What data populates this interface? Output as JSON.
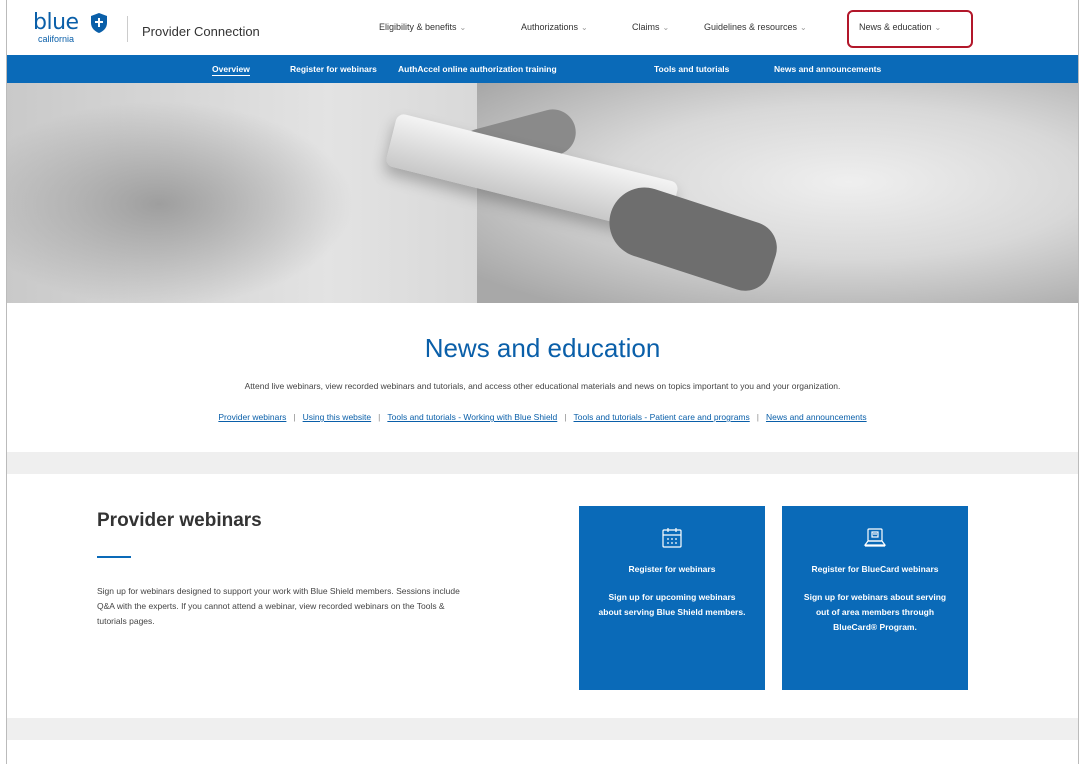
{
  "brand": {
    "logo_word": "blue",
    "logo_sub": "california",
    "name": "Provider Connection"
  },
  "topnav": [
    {
      "label": "Eligibility & benefits"
    },
    {
      "label": "Authorizations"
    },
    {
      "label": "Claims"
    },
    {
      "label": "Guidelines & resources"
    },
    {
      "label": "News & education"
    }
  ],
  "subnav": [
    {
      "label": "Overview"
    },
    {
      "label": "Register for webinars"
    },
    {
      "label": "AuthAccel online authorization training"
    },
    {
      "label": "Tools and tutorials"
    },
    {
      "label": "News and announcements"
    }
  ],
  "intro": {
    "title": "News and education",
    "description": "Attend live webinars, view recorded webinars and tutorials, and access other educational materials and news on topics important to you and your organization.",
    "links": [
      "Provider webinars",
      "Using this website",
      "Tools and tutorials - Working with Blue Shield",
      "Tools and tutorials - Patient care and programs",
      "News and announcements"
    ],
    "separator": "|"
  },
  "webinars": {
    "title": "Provider webinars",
    "description": "Sign up for webinars designed to support your work with Blue Shield members. Sessions include Q&A with the experts. If you cannot attend a webinar, view recorded webinars on the Tools & tutorials pages.",
    "cards": [
      {
        "title": "Register for webinars",
        "description": "Sign up for upcoming webinars about serving Blue Shield members.",
        "icon": "calendar-icon"
      },
      {
        "title": "Register for BlueCard webinars",
        "description": "Sign up for webinars about serving out of area members through BlueCard® Program.",
        "icon": "laptop-icon"
      }
    ]
  },
  "colors": {
    "brand_blue": "#0a6ab8",
    "highlight_red": "#b2172a"
  }
}
